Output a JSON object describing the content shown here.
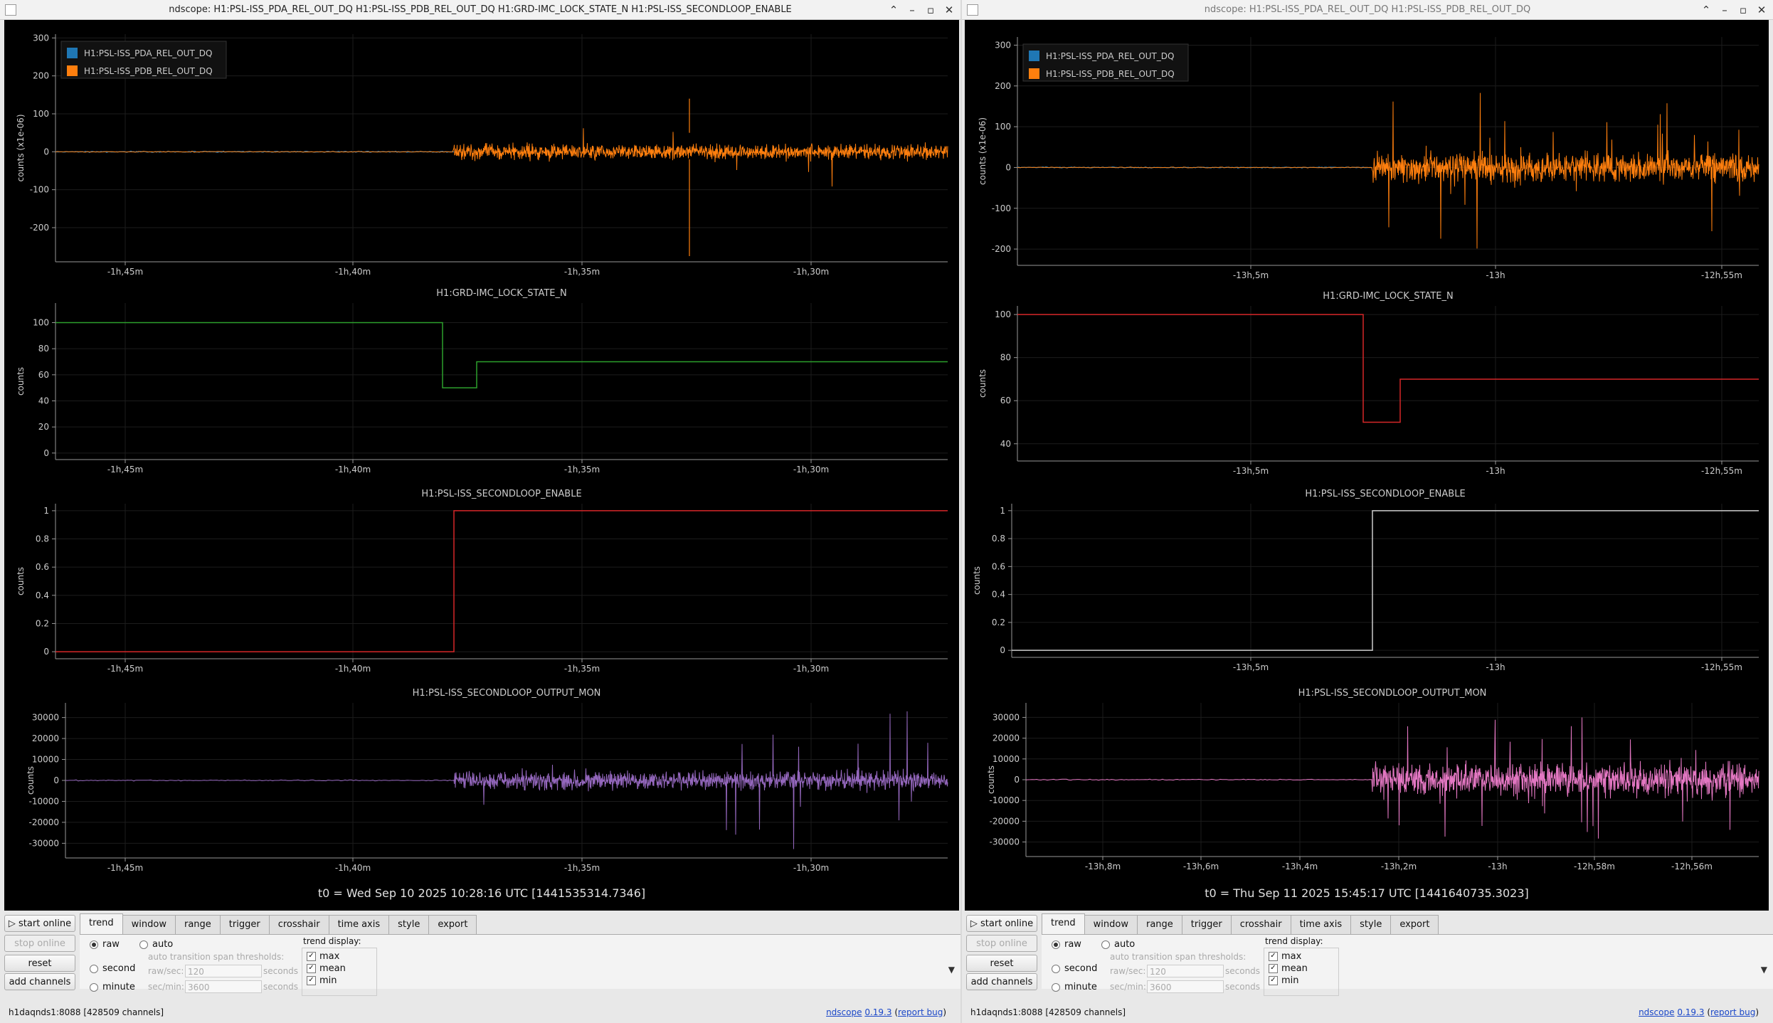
{
  "windows": [
    {
      "id": "left",
      "title": "ndscope: H1:PSL-ISS_PDA_REL_OUT_DQ H1:PSL-ISS_PDB_REL_OUT_DQ H1:GRD-IMC_LOCK_STATE_N H1:PSL-ISS_SECONDLOOP_ENABLE",
      "t0": "t0 = Wed Sep 10 2025 10:28:16 UTC [1441535314.7346]",
      "plots": [
        {
          "title": "",
          "ylabel": "counts (x1e-06)",
          "yticks": [
            "300",
            "200",
            "100",
            "0",
            "-100",
            "-200"
          ],
          "xticks": [
            "-1h,45m",
            "-1h,40m",
            "-1h,35m",
            "-1h,30m"
          ],
          "legend": [
            {
              "name": "H1:PSL-ISS_PDA_REL_OUT_DQ",
              "color": "#1f77b4"
            },
            {
              "name": "H1:PSL-ISS_PDB_REL_OUT_DQ",
              "color": "#ff7f0e"
            }
          ]
        },
        {
          "title": "H1:GRD-IMC_LOCK_STATE_N",
          "ylabel": "counts",
          "yticks": [
            "100",
            "80",
            "60",
            "40",
            "20",
            "0"
          ],
          "xticks": [
            "-1h,45m",
            "-1h,40m",
            "-1h,35m",
            "-1h,30m"
          ]
        },
        {
          "title": "H1:PSL-ISS_SECONDLOOP_ENABLE",
          "ylabel": "counts",
          "yticks": [
            "1",
            "0.8",
            "0.6",
            "0.4",
            "0.2",
            "0"
          ],
          "xticks": [
            "-1h,45m",
            "-1h,40m",
            "-1h,35m",
            "-1h,30m"
          ]
        },
        {
          "title": "H1:PSL-ISS_SECONDLOOP_OUTPUT_MON",
          "ylabel": "counts",
          "yticks": [
            "30000",
            "20000",
            "10000",
            "0",
            "-10000",
            "-20000",
            "-30000"
          ],
          "xticks": [
            "-1h,45m",
            "-1h,40m",
            "-1h,35m",
            "-1h,30m"
          ]
        }
      ],
      "controls": {
        "start_online": "start online",
        "stop_online": "stop online",
        "reset": "reset",
        "add_channels": "add channels",
        "tabs": [
          "trend",
          "window",
          "range",
          "trigger",
          "crosshair",
          "time axis",
          "style",
          "export"
        ],
        "mode_raw": "raw",
        "mode_second": "second",
        "mode_minute": "minute",
        "mode_auto": "auto",
        "thresholds_label": "auto transition span thresholds:",
        "raw_sec_label": "raw/sec:",
        "raw_sec_value": "120",
        "sec_min_label": "sec/min:",
        "sec_min_value": "3600",
        "seconds": "seconds",
        "trend_display": "trend display:",
        "max": "max",
        "mean": "mean",
        "min": "min",
        "status": "h1daqnds1:8088  [428509 channels]",
        "ver_name": "ndscope",
        "ver_num": "0.19.3",
        "ver_bug": "report bug"
      }
    },
    {
      "id": "right",
      "title": "ndscope: H1:PSL-ISS_PDA_REL_OUT_DQ H1:PSL-ISS_PDB_REL_OUT_DQ",
      "t0": "t0 = Thu Sep 11 2025 15:45:17 UTC [1441640735.3023]",
      "plots": [
        {
          "title": "",
          "ylabel": "counts (x1e-06)",
          "yticks": [
            "300",
            "200",
            "100",
            "0",
            "-100",
            "-200"
          ],
          "xticks": [
            "-13h,5m",
            "-13h",
            "-12h,55m"
          ],
          "legend": [
            {
              "name": "H1:PSL-ISS_PDA_REL_OUT_DQ",
              "color": "#1f77b4"
            },
            {
              "name": "H1:PSL-ISS_PDB_REL_OUT_DQ",
              "color": "#ff7f0e"
            }
          ]
        },
        {
          "title": "H1:GRD-IMC_LOCK_STATE_N",
          "ylabel": "counts",
          "yticks": [
            "100",
            "80",
            "60",
            "40"
          ],
          "xticks": [
            "-13h,5m",
            "-13h",
            "-12h,55m"
          ]
        },
        {
          "title": "H1:PSL-ISS_SECONDLOOP_ENABLE",
          "ylabel": "counts",
          "yticks": [
            "1",
            "0.8",
            "0.6",
            "0.4",
            "0.2",
            "0"
          ],
          "xticks": [
            "-13h,5m",
            "-13h",
            "-12h,55m"
          ]
        },
        {
          "title": "H1:PSL-ISS_SECONDLOOP_OUTPUT_MON",
          "ylabel": "counts",
          "yticks": [
            "30000",
            "20000",
            "10000",
            "0",
            "-10000",
            "-20000",
            "-30000"
          ],
          "xticks": [
            "-13h,8m",
            "-13h,6m",
            "-13h,4m",
            "-13h,2m",
            "-13h",
            "-12h,58m",
            "-12h,56m"
          ]
        }
      ],
      "controls": {
        "start_online": "start online",
        "stop_online": "stop online",
        "reset": "reset",
        "add_channels": "add channels",
        "tabs": [
          "trend",
          "window",
          "range",
          "trigger",
          "crosshair",
          "time axis",
          "style",
          "export"
        ],
        "mode_raw": "raw",
        "mode_second": "second",
        "mode_minute": "minute",
        "mode_auto": "auto",
        "thresholds_label": "auto transition span thresholds:",
        "raw_sec_label": "raw/sec:",
        "raw_sec_value": "120",
        "sec_min_label": "sec/min:",
        "sec_min_value": "3600",
        "seconds": "seconds",
        "trend_display": "trend display:",
        "max": "max",
        "mean": "mean",
        "min": "min",
        "status": "h1daqnds1:8088  [428509 channels]",
        "ver_name": "ndscope",
        "ver_num": "0.19.3",
        "ver_bug": "report bug"
      }
    }
  ],
  "chart_data": [
    {
      "type": "line",
      "window": "left",
      "title": "",
      "ylabel": "counts (x1e-06)",
      "ylim": [
        -290,
        310
      ],
      "xlim_min": [
        -107.2,
        -26.4
      ],
      "transition_min": -97.7,
      "grid": true,
      "legend": "top-left",
      "series": [
        {
          "name": "H1:PSL-ISS_PDA_REL_OUT_DQ",
          "color": "#1f77b4",
          "quiet_amplitude": 2
        },
        {
          "name": "H1:PSL-ISS_PDB_REL_OUT_DQ",
          "color": "#ff7f0e",
          "amplitude_after": 25,
          "spike_max": 140,
          "spike_min": -275
        }
      ]
    },
    {
      "type": "line",
      "window": "left",
      "title": "H1:GRD-IMC_LOCK_STATE_N",
      "ylabel": "counts",
      "ylim": [
        -5,
        115
      ],
      "grid": true,
      "color": "#2ca02c",
      "steps": [
        {
          "x_min": -107.2,
          "y": 100
        },
        {
          "x_min": -98.7,
          "y": 50
        },
        {
          "x_min": -97.0,
          "y": 70
        }
      ]
    },
    {
      "type": "line",
      "window": "left",
      "title": "H1:PSL-ISS_SECONDLOOP_ENABLE",
      "ylabel": "counts",
      "ylim": [
        -0.05,
        1.05
      ],
      "grid": true,
      "color": "#d62728",
      "steps": [
        {
          "x_min": -107.2,
          "y": 0
        },
        {
          "x_min": -97.7,
          "y": 1
        }
      ]
    },
    {
      "type": "line",
      "window": "left",
      "title": "H1:PSL-ISS_SECONDLOOP_OUTPUT_MON",
      "ylabel": "counts",
      "ylim": [
        -37000,
        37000
      ],
      "grid": true,
      "color": "#9467bd",
      "amplitude_after": 5000,
      "spike_max": 33000
    },
    {
      "type": "line",
      "window": "right",
      "title": "",
      "ylabel": "counts (x1e-06)",
      "ylim": [
        -240,
        320
      ],
      "transition_min": -782.6,
      "grid": true,
      "legend": "top-left",
      "series": [
        {
          "name": "H1:PSL-ISS_PDA_REL_OUT_DQ",
          "color": "#1f77b4",
          "quiet_amplitude": 2
        },
        {
          "name": "H1:PSL-ISS_PDB_REL_OUT_DQ",
          "color": "#ff7f0e",
          "amplitude_after": 45,
          "spike_max": 295,
          "spike_min": -215
        }
      ]
    },
    {
      "type": "line",
      "window": "right",
      "title": "H1:GRD-IMC_LOCK_STATE_N",
      "ylabel": "counts",
      "ylim": [
        32,
        104
      ],
      "grid": true,
      "color": "#d62728",
      "steps": [
        {
          "y": 100
        },
        {
          "y": 50
        },
        {
          "y": 70
        }
      ]
    },
    {
      "type": "line",
      "window": "right",
      "title": "H1:PSL-ISS_SECONDLOOP_ENABLE",
      "ylabel": "counts",
      "ylim": [
        -0.05,
        1.05
      ],
      "grid": true,
      "color": "#cccccc",
      "steps": [
        {
          "y": 0
        },
        {
          "y": 1
        }
      ]
    },
    {
      "type": "line",
      "window": "right",
      "title": "H1:PSL-ISS_SECONDLOOP_OUTPUT_MON",
      "ylabel": "counts",
      "ylim": [
        -37000,
        37000
      ],
      "grid": true,
      "color": "#e377c2",
      "amplitude_after": 9000,
      "spike_max": 32000
    }
  ]
}
